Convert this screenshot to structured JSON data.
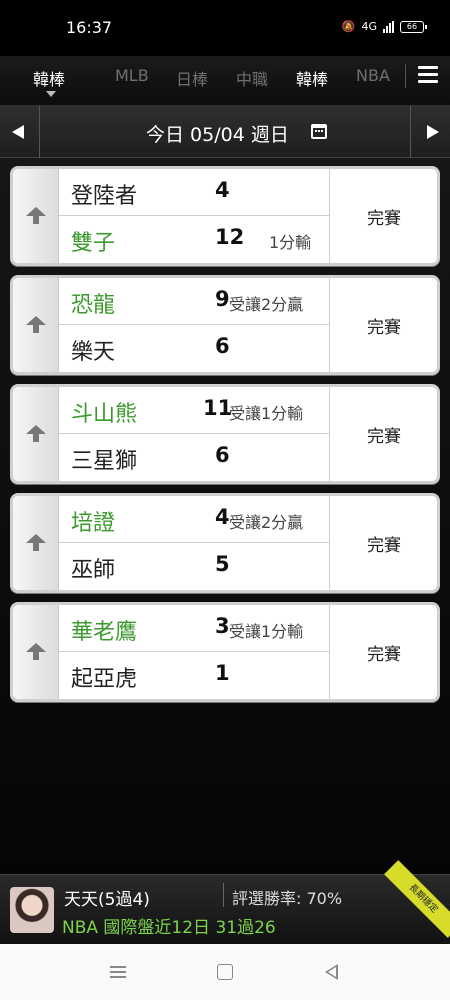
{
  "status_bar": {
    "time": "16:37",
    "network_label": "4G",
    "battery": "66"
  },
  "tabs": {
    "current": "韓棒",
    "items": [
      "MLB",
      "日棒",
      "中職",
      "韓棒",
      "NBA"
    ]
  },
  "date_bar": {
    "label": "今日 05/04 週日"
  },
  "games": [
    {
      "home": {
        "name": "登陸者",
        "score": "4",
        "note": ""
      },
      "away": {
        "name": "雙子",
        "score": "12",
        "note": "1分輸"
      },
      "status": "完賽"
    },
    {
      "home": {
        "name": "恐龍",
        "score": "9",
        "note": "受讓2分贏"
      },
      "away": {
        "name": "樂天",
        "score": "6",
        "note": ""
      },
      "status": "完賽"
    },
    {
      "home": {
        "name": "斗山熊",
        "score": "11",
        "note": "受讓1分輸"
      },
      "away": {
        "name": "三星獅",
        "score": "6",
        "note": ""
      },
      "status": "完賽"
    },
    {
      "home": {
        "name": "培證",
        "score": "4",
        "note": "受讓2分贏"
      },
      "away": {
        "name": "巫師",
        "score": "5",
        "note": ""
      },
      "status": "完賽"
    },
    {
      "home": {
        "name": "華老鷹",
        "score": "3",
        "note": "受讓1分輸"
      },
      "away": {
        "name": "起亞虎",
        "score": "1",
        "note": ""
      },
      "status": "完賽"
    }
  ],
  "promo": {
    "user": "天天(5過4)",
    "rate": "評選勝率: 70%",
    "record": "NBA 國際盤近12日 31過26",
    "ribbon": "長期穩定"
  },
  "colors": {
    "win_team": "#3c9a2e",
    "promo_record": "#7bd44a"
  }
}
